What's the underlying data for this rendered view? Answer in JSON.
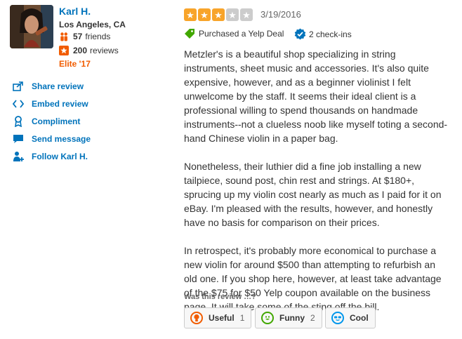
{
  "user": {
    "name": "Karl H.",
    "location": "Los Angeles, CA",
    "friends_count": "57",
    "friends_label": "friends",
    "reviews_count": "200",
    "reviews_label": "reviews",
    "elite": "Elite '17"
  },
  "actions": [
    {
      "label": "Share review",
      "icon": "share-icon"
    },
    {
      "label": "Embed review",
      "icon": "embed-icon"
    },
    {
      "label": "Compliment",
      "icon": "award-icon"
    },
    {
      "label": "Send message",
      "icon": "message-icon"
    },
    {
      "label": "Follow Karl H.",
      "icon": "follow-icon"
    }
  ],
  "review": {
    "rating": 3,
    "rating_max": 5,
    "date": "3/19/2016",
    "deal_label": "Purchased a Yelp Deal",
    "checkins_label": "2 check-ins",
    "paragraphs": [
      "Metzler's is a beautiful shop specializing in string instruments, sheet music and accessories. It's also quite expensive, however, and as a beginner violinist I felt unwelcome by the staff. It seems their ideal client is a professional willing to spend thousands on handmade instruments--not a clueless noob like myself toting a second-hand Chinese violin in a paper bag.",
      "Nonetheless, their luthier did a fine job installing a new tailpiece, sound post, chin rest and strings. At $180+, sprucing up my violin cost nearly as much as I paid for it on eBay. I'm pleased with the results, however, and honestly have no basis for comparison on their prices.",
      "In retrospect, it's probably more economical to purchase a new violin for around $500 than attempting to refurbish an old one. If you shop here, however, at least take advantage of the $75 for $50 Yelp coupon available on the business page. It will take some of the sting off the bill."
    ]
  },
  "feedback": {
    "prompt": "Was this review …?",
    "useful_label": "Useful",
    "useful_count": "1",
    "funny_label": "Funny",
    "funny_count": "2",
    "cool_label": "Cool"
  },
  "colors": {
    "link": "#0073bb",
    "star_filled": "#f8a42a",
    "star_empty": "#cccccc",
    "elite": "#f15c00",
    "deal_tag": "#41a700",
    "useful": "#f15c00",
    "funny": "#41a700",
    "cool": "#0097ec"
  }
}
